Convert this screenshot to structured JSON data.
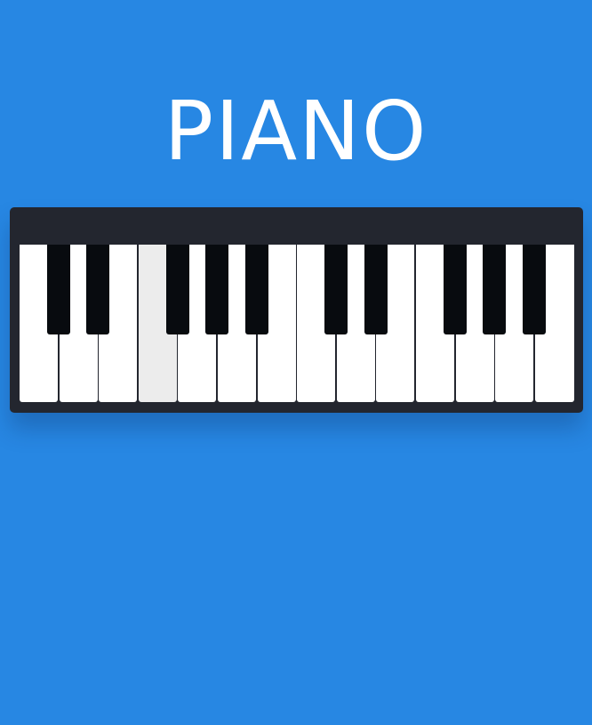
{
  "app": {
    "title": "PIANO"
  },
  "colors": {
    "background": "#2787e3",
    "piano_body": "#23262f",
    "white_key": "#ffffff",
    "white_key_pressed": "#ececec",
    "black_key": "#080b0f"
  },
  "keyboard": {
    "white_keys": [
      {
        "note": "C"
      },
      {
        "note": "D"
      },
      {
        "note": "E"
      },
      {
        "note": "F",
        "pressed": true
      },
      {
        "note": "G"
      },
      {
        "note": "A"
      },
      {
        "note": "B"
      },
      {
        "note": "C"
      },
      {
        "note": "D"
      },
      {
        "note": "E"
      },
      {
        "note": "F"
      },
      {
        "note": "G"
      },
      {
        "note": "A"
      },
      {
        "note": "B"
      }
    ],
    "black_keys": [
      {
        "note": "C#",
        "after_white": 0
      },
      {
        "note": "D#",
        "after_white": 1
      },
      {
        "note": "F#",
        "after_white": 3
      },
      {
        "note": "G#",
        "after_white": 4
      },
      {
        "note": "A#",
        "after_white": 5
      },
      {
        "note": "C#",
        "after_white": 7
      },
      {
        "note": "D#",
        "after_white": 8
      },
      {
        "note": "F#",
        "after_white": 10
      },
      {
        "note": "G#",
        "after_white": 11
      },
      {
        "note": "A#",
        "after_white": 12
      }
    ]
  }
}
